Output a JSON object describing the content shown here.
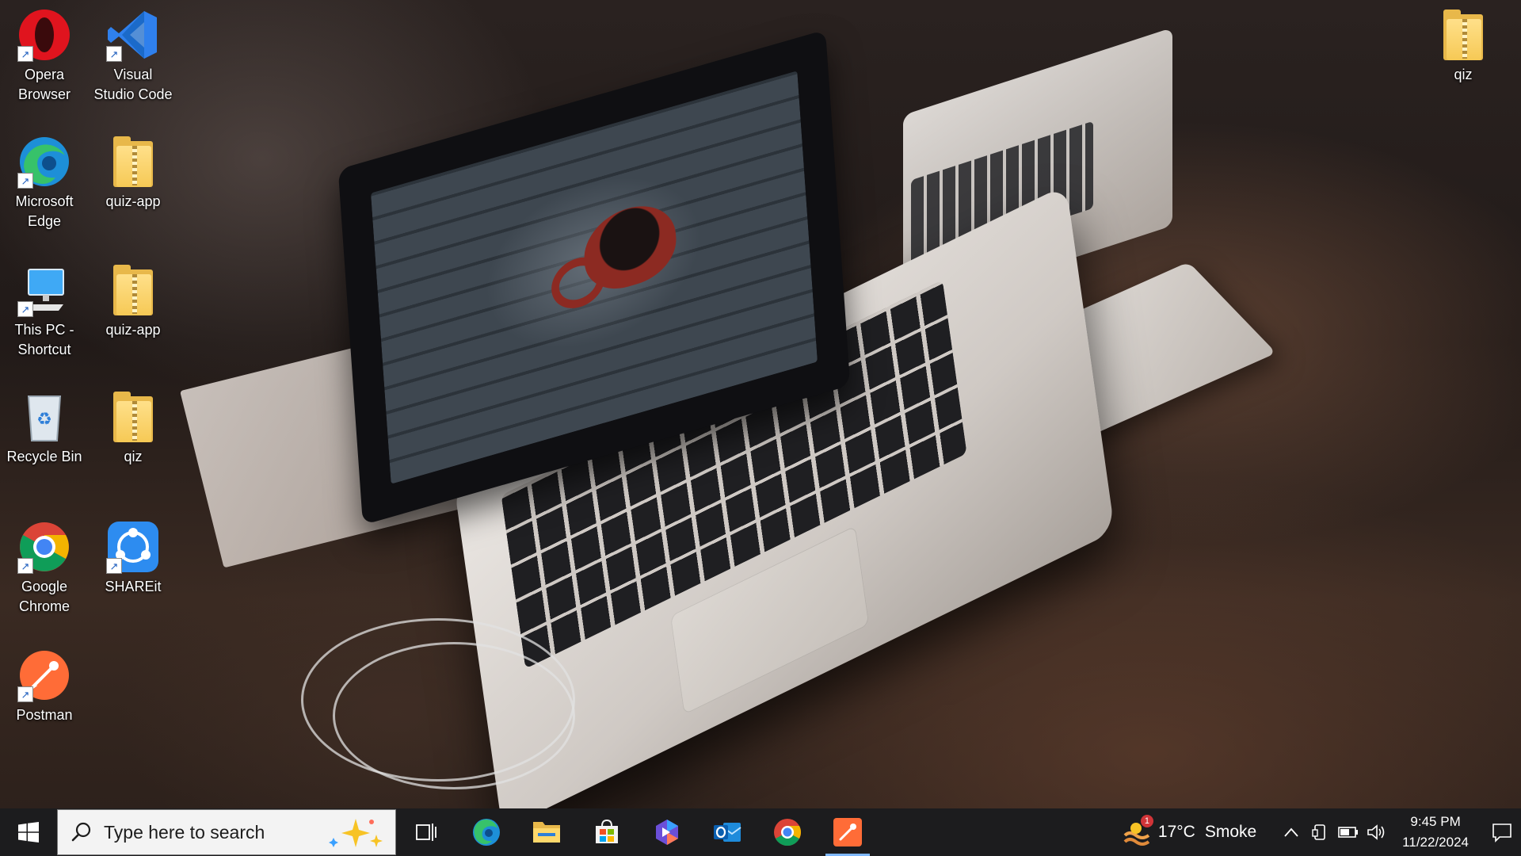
{
  "desktop": {
    "icons": [
      {
        "label": "Opera Browser",
        "icon": "opera-icon"
      },
      {
        "label": "Visual Studio Code",
        "icon": "vscode-icon"
      },
      {
        "label": "Microsoft Edge",
        "icon": "edge-icon"
      },
      {
        "label": "quiz-app",
        "icon": "zip-folder-icon"
      },
      {
        "label": "This PC - Shortcut",
        "icon": "computer-icon"
      },
      {
        "label": "quiz-app",
        "icon": "folder-icon"
      },
      {
        "label": "Recycle Bin",
        "icon": "recycle-bin-icon"
      },
      {
        "label": "qiz",
        "icon": "zip-folder-icon"
      },
      {
        "label": "Google Chrome",
        "icon": "chrome-icon"
      },
      {
        "label": "SHAREit",
        "icon": "shareit-icon"
      },
      {
        "label": "Postman",
        "icon": "postman-icon"
      },
      {
        "label": "qiz",
        "icon": "folder-icon"
      }
    ]
  },
  "taskbar": {
    "search_placeholder": "Type here to search",
    "apps": [
      {
        "name": "Task View",
        "icon": "task-view-icon"
      },
      {
        "name": "Microsoft Edge",
        "icon": "edge-icon"
      },
      {
        "name": "File Explorer",
        "icon": "file-explorer-icon"
      },
      {
        "name": "Microsoft Store",
        "icon": "store-icon"
      },
      {
        "name": "Copilot",
        "icon": "copilot-icon"
      },
      {
        "name": "Outlook",
        "icon": "outlook-icon"
      },
      {
        "name": "Google Chrome",
        "icon": "chrome-icon"
      },
      {
        "name": "Postman",
        "icon": "postman-icon",
        "active": true
      }
    ],
    "weather": {
      "badge": "1",
      "temp": "17°C",
      "condition": "Smoke"
    },
    "clock": {
      "time": "9:45 PM",
      "date": "11/22/2024"
    }
  },
  "colors": {
    "taskbar": "#1c1c1e",
    "active_indicator": "#7fb8ff",
    "opera": "#e0141e",
    "vscode": "#2f80ed",
    "postman": "#ff6c37",
    "shareit": "#2d8cf0"
  }
}
